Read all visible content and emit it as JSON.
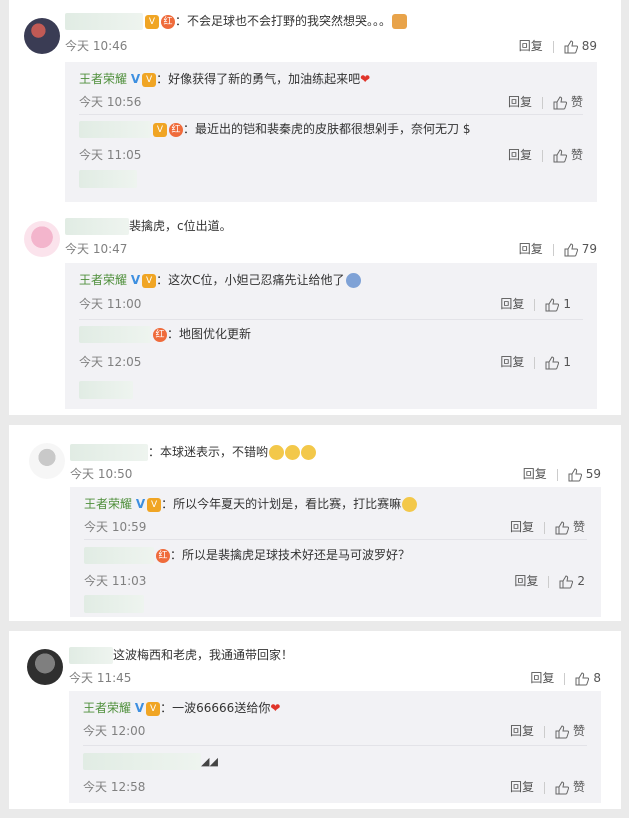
{
  "labels": {
    "reply": "回复",
    "like_word": "赞"
  },
  "comments": [
    {
      "text": "：不会足球也不会打野的我突然想哭。。。",
      "time": "今天 10:46",
      "likes": "89",
      "replies": [
        {
          "author": "王者荣耀",
          "text": "：好像获得了新的勇气，加油练起来吧",
          "time": "今天 10:56"
        },
        {
          "text": "：最近出的铠和裴秦虎的皮肤都很想剁手，奈何无刀 $",
          "time": "今天 11:05"
        }
      ]
    },
    {
      "text": "裴擒虎，c位出道。",
      "time": "今天 10:47",
      "likes": "79",
      "replies": [
        {
          "author": "王者荣耀",
          "text": "：这次C位，小妲己忍痛先让给他了",
          "time": "今天 11:00",
          "likes": "1"
        },
        {
          "text": "：地图优化更新",
          "time": "今天 12:05",
          "likes": "1"
        }
      ]
    },
    {
      "text": "：本球迷表示，不错哟",
      "time": "今天 10:50",
      "likes": "59",
      "replies": [
        {
          "author": "王者荣耀",
          "text": "：所以今年夏天的计划是，看比赛，打比赛嘛",
          "time": "今天 10:59"
        },
        {
          "text": "：所以是裴擒虎足球技术好还是马可波罗好？",
          "time": "今天 11:03",
          "likes": "2"
        }
      ]
    },
    {
      "text": "这波梅西和老虎，我通通带回家！",
      "time": "今天 11:45",
      "likes": "8",
      "replies": [
        {
          "author": "王者荣耀",
          "text": "：一波66666送给你",
          "time": "今天 12:00"
        },
        {
          "text": "",
          "time": "今天 12:58"
        }
      ]
    }
  ]
}
